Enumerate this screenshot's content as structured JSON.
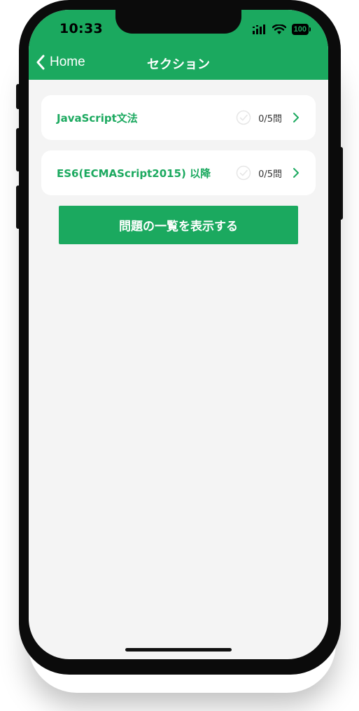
{
  "status_bar": {
    "time": "10:33",
    "battery": "100",
    "icons": [
      "signal-icon",
      "wifi-icon",
      "battery-icon"
    ]
  },
  "nav": {
    "back_label": "Home",
    "title": "セクション"
  },
  "sections": [
    {
      "label": "JavaScript文法",
      "progress": "0/5問"
    },
    {
      "label": "ES6(ECMAScript2015) 以降",
      "progress": "0/5問"
    }
  ],
  "actions": {
    "show_list_label": "問題の一覧を表示する"
  },
  "colors": {
    "accent": "#1ba95f",
    "background": "#f4f4f4",
    "card": "#ffffff"
  }
}
